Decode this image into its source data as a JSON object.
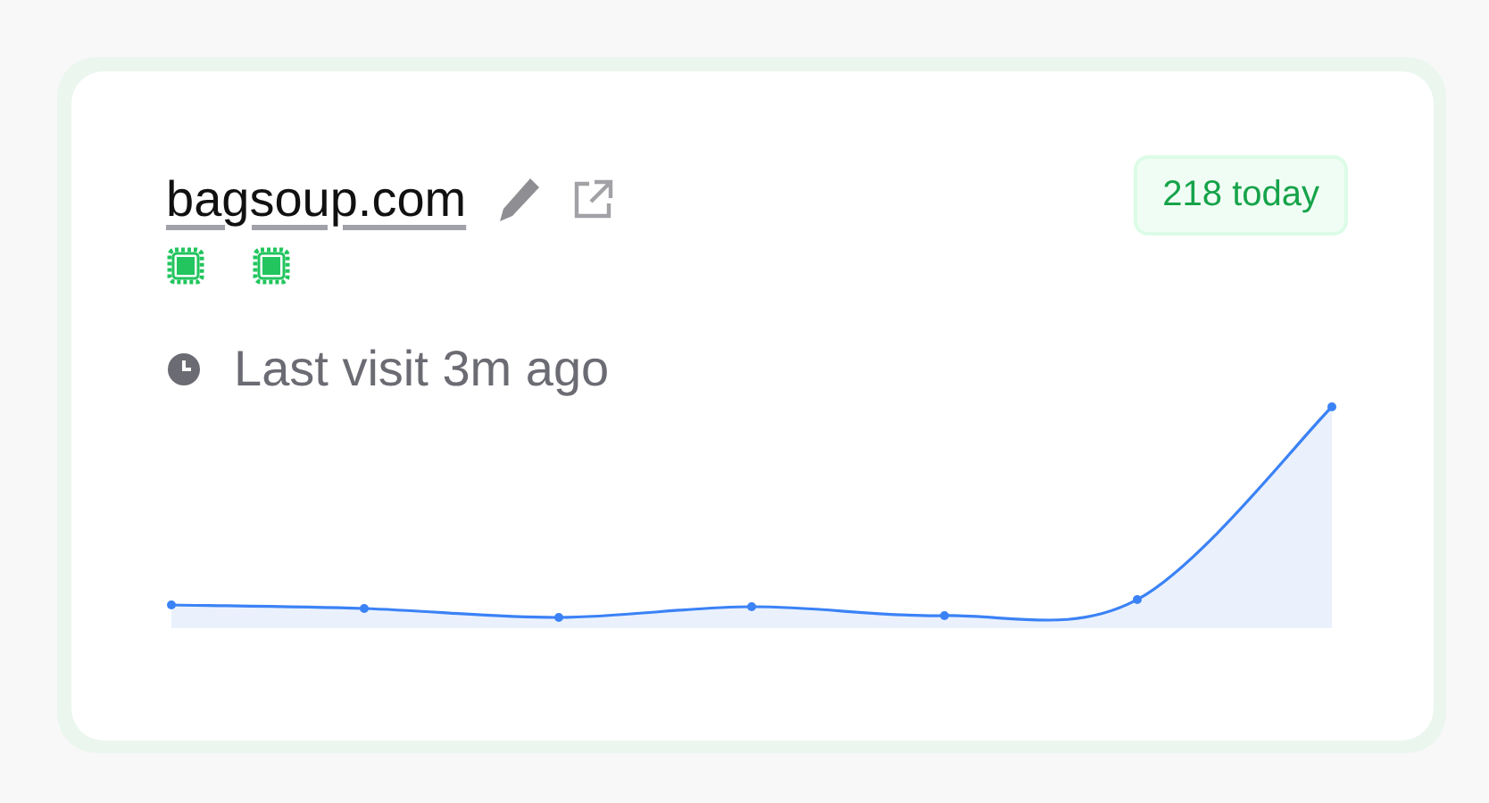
{
  "site": {
    "domain": "bagsoup.com",
    "visits_badge": "218 today"
  },
  "last_visit": "Last visit 3m ago"
}
